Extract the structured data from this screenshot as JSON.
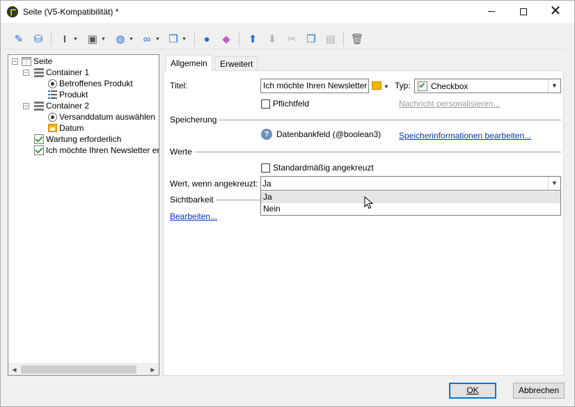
{
  "window": {
    "title": "Seite (V5-Kompatibilität) *",
    "minimize": "—",
    "maximize": "☐",
    "close": "✕"
  },
  "toolbar": {
    "items": [
      {
        "name": "wizard-icon",
        "glyph": "✎",
        "color": "#1e6fd0"
      },
      {
        "name": "database-icon",
        "glyph": "⛁",
        "color": "#1e6fd0"
      },
      {
        "name": "text-cursor-icon",
        "glyph": "I",
        "color": "#555555"
      },
      {
        "name": "field-add-icon",
        "glyph": "▣",
        "color": "#555555"
      },
      {
        "name": "globe-icon",
        "glyph": "◍",
        "color": "#1e6fd0"
      },
      {
        "name": "link-icon",
        "glyph": "∞",
        "color": "#1e6fd0"
      },
      {
        "name": "package-icon",
        "glyph": "❒",
        "color": "#1e6fd0"
      },
      {
        "name": "user-icon",
        "glyph": "●",
        "color": "#1e6fd0"
      },
      {
        "name": "shapes-icon",
        "glyph": "◆",
        "color": "#c060c0"
      },
      {
        "name": "arrow-up-icon",
        "glyph": "⬆",
        "color": "#1e6fd0"
      },
      {
        "name": "arrow-down-icon",
        "glyph": "⬇",
        "color": "#b0b0b0"
      },
      {
        "name": "cut-icon",
        "glyph": "✂",
        "color": "#b0b0b0"
      },
      {
        "name": "copy-icon",
        "glyph": "❐",
        "color": "#1e6fd0"
      },
      {
        "name": "paste-icon",
        "glyph": "▤",
        "color": "#b0b0b0"
      },
      {
        "name": "delete-icon",
        "glyph": "🗑",
        "color": "#666666"
      }
    ]
  },
  "tree": {
    "nodes": [
      {
        "label": "Seite",
        "icon": "page-icon"
      },
      {
        "label": "Container 1",
        "icon": "container-icon"
      },
      {
        "label": "Betroffenes Produkt",
        "icon": "radio-icon"
      },
      {
        "label": "Produkt",
        "icon": "list-icon"
      },
      {
        "label": "Container 2",
        "icon": "container-icon"
      },
      {
        "label": "Versanddatum auswählen",
        "icon": "radio-icon"
      },
      {
        "label": "Datum",
        "icon": "date-icon"
      },
      {
        "label": "Wartung erforderlich",
        "icon": "checkbox-icon"
      },
      {
        "label": "Ich möchte Ihren Newsletter er",
        "icon": "checkbox-icon"
      }
    ]
  },
  "tabs": {
    "general": "Allgemein",
    "advanced": "Erweitert"
  },
  "form": {
    "title_label": "Titel:",
    "title_value": "Ich möchte Ihren Newsletter",
    "type_label": "Typ:",
    "type_value": "Checkbox",
    "required_label": "Pflichtfeld",
    "personalize_link": "Nachricht personalisieren...",
    "storage_section": "Speicherung",
    "db_field": "Datenbankfeld (@boolean3)",
    "storage_link": "Speicherinformationen bearbeiten...",
    "values_section": "Werte",
    "default_checked_label": "Standardmäßig angekreuzt",
    "checked_value_label": "Wert, wenn angekreuzt:",
    "checked_value": "Ja",
    "visibility_section": "Sichtbarkeit",
    "edit_link": "Bearbeiten..."
  },
  "dropdown": {
    "options": [
      "Ja",
      "Nein"
    ]
  },
  "buttons": {
    "ok": "OK",
    "cancel": "Abbrechen"
  },
  "colors": {
    "accent": "#0078d7",
    "link": "#0033cc"
  }
}
